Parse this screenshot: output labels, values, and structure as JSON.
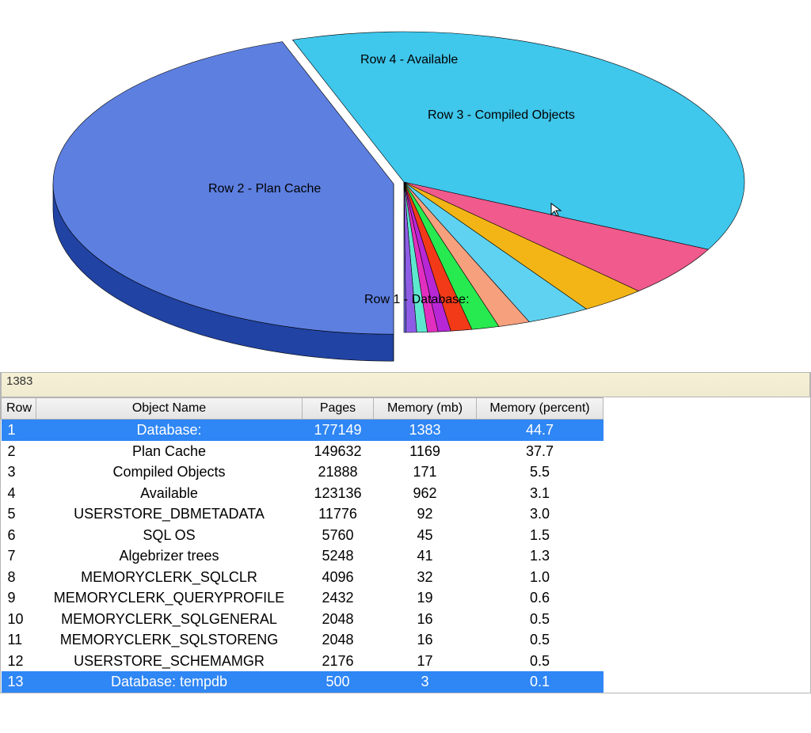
{
  "status_value": "1383",
  "headers": {
    "row": "Row",
    "name": "Object Name",
    "pages": "Pages",
    "mem_mb": "Memory (mb)",
    "mem_pct": "Memory (percent)"
  },
  "rows": [
    {
      "row": "1",
      "name": "Database:",
      "pages": "177149",
      "mb": "1383",
      "pct": "44.7",
      "sel": true
    },
    {
      "row": "2",
      "name": "Plan Cache",
      "pages": "149632",
      "mb": "1169",
      "pct": "37.7",
      "sel": false
    },
    {
      "row": "3",
      "name": "Compiled Objects",
      "pages": "21888",
      "mb": "171",
      "pct": "5.5",
      "sel": false
    },
    {
      "row": "4",
      "name": "Available",
      "pages": "123136",
      "mb": "962",
      "pct": "3.1",
      "sel": false
    },
    {
      "row": "5",
      "name": "USERSTORE_DBMETADATA",
      "pages": "11776",
      "mb": "92",
      "pct": "3.0",
      "sel": false
    },
    {
      "row": "6",
      "name": "SQL OS",
      "pages": "5760",
      "mb": "45",
      "pct": "1.5",
      "sel": false
    },
    {
      "row": "7",
      "name": "Algebrizer trees",
      "pages": "5248",
      "mb": "41",
      "pct": "1.3",
      "sel": false
    },
    {
      "row": "8",
      "name": "MEMORYCLERK_SQLCLR",
      "pages": "4096",
      "mb": "32",
      "pct": "1.0",
      "sel": false
    },
    {
      "row": "9",
      "name": "MEMORYCLERK_QUERYPROFILE",
      "pages": "2432",
      "mb": "19",
      "pct": "0.6",
      "sel": false
    },
    {
      "row": "10",
      "name": "MEMORYCLERK_SQLGENERAL",
      "pages": "2048",
      "mb": "16",
      "pct": "0.5",
      "sel": false
    },
    {
      "row": "11",
      "name": "MEMORYCLERK_SQLSTORENG",
      "pages": "2048",
      "mb": "16",
      "pct": "0.5",
      "sel": false
    },
    {
      "row": "12",
      "name": "USERSTORE_SCHEMAMGR",
      "pages": "2176",
      "mb": "17",
      "pct": "0.5",
      "sel": false
    },
    {
      "row": "13",
      "name": "Database: tempdb",
      "pages": "500",
      "mb": "3",
      "pct": "0.1",
      "sel": true
    }
  ],
  "chart_data": {
    "type": "pie",
    "title": "",
    "labels": {
      "main_slice": "Row 1 - Database:",
      "plan_cache": "Row 2 - Plan Cache",
      "compiled": "Row 3 - Compiled Objects",
      "available": "Row 4 - Available"
    },
    "series": [
      {
        "name": "Database",
        "row": 1,
        "percent": 44.7,
        "label": "Row 1 - Database:",
        "color": "#5d7fe0",
        "exploded": true
      },
      {
        "name": "Plan Cache",
        "row": 2,
        "percent": 37.7,
        "label": "Row 2 - Plan Cache",
        "color": "#3fc7ec",
        "exploded": false
      },
      {
        "name": "Compiled Objects",
        "row": 3,
        "percent": 5.5,
        "label": "Row 3 - Compiled Objects",
        "color": "#f05a8c",
        "exploded": false
      },
      {
        "name": "Available",
        "row": 4,
        "percent": 3.1,
        "label": "Row 4 - Available",
        "color": "#f3b516",
        "exploded": false
      },
      {
        "name": "USERSTORE_DBMETADATA",
        "row": 5,
        "percent": 3.0,
        "label": "",
        "color": "#5fd2f2",
        "exploded": false
      },
      {
        "name": "SQL OS",
        "row": 6,
        "percent": 1.5,
        "label": "",
        "color": "#f7a07e",
        "exploded": false
      },
      {
        "name": "Algebrizer trees",
        "row": 7,
        "percent": 1.3,
        "label": "",
        "color": "#26ea4f",
        "exploded": false
      },
      {
        "name": "MEMORYCLERK_SQLCLR",
        "row": 8,
        "percent": 1.0,
        "label": "",
        "color": "#f23a18",
        "exploded": false
      },
      {
        "name": "MEMORYCLERK_QUERYPROFILE",
        "row": 9,
        "percent": 0.6,
        "label": "",
        "color": "#b827d6",
        "exploded": false
      },
      {
        "name": "MEMORYCLERK_SQLGENERAL",
        "row": 10,
        "percent": 0.5,
        "label": "",
        "color": "#e22fc0",
        "exploded": false
      },
      {
        "name": "MEMORYCLERK_SQLSTORENG",
        "row": 11,
        "percent": 0.5,
        "label": "",
        "color": "#5de7cf",
        "exploded": false
      },
      {
        "name": "USERSTORE_SCHEMAMGR",
        "row": 12,
        "percent": 0.5,
        "label": "",
        "color": "#8e5de6",
        "exploded": false
      },
      {
        "name": "Database: tempdb",
        "row": 13,
        "percent": 0.1,
        "label": "",
        "color": "#6b6fe0",
        "exploded": false
      }
    ]
  }
}
